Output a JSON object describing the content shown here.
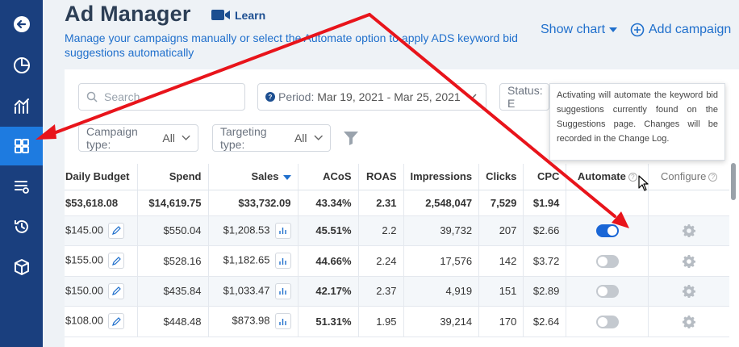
{
  "header": {
    "title": "Ad Manager",
    "learn_label": "Learn",
    "subtitle": "Manage your campaigns manually or select the Automate option to apply ADS keyword bid suggestions automatically",
    "show_chart_label": "Show chart",
    "add_campaign_label": "Add campaign"
  },
  "sidebar": {
    "items": [
      {
        "icon": "back-arrow-icon"
      },
      {
        "icon": "pie-chart-icon"
      },
      {
        "icon": "analytics-icon"
      },
      {
        "icon": "grid-icon",
        "active": true
      },
      {
        "icon": "list-settings-icon"
      },
      {
        "icon": "history-icon"
      },
      {
        "icon": "box-icon"
      }
    ]
  },
  "filters": {
    "search_placeholder": "Search",
    "period_label": "Period:",
    "period_value": "Mar 19, 2021 - Mar 25, 2021",
    "status_label": "Status: E",
    "campaign_type_label": "Campaign type:",
    "campaign_type_value": "All",
    "targeting_type_label": "Targeting type:",
    "targeting_type_value": "All"
  },
  "tooltip": {
    "text": "Activating will automate the keyword bid suggestions currently found on the Suggestions page. Changes will be recorded in the Change Log."
  },
  "table": {
    "headers": {
      "daily_budget": "Daily Budget",
      "spend": "Spend",
      "sales": "Sales",
      "acos": "ACoS",
      "roas": "ROAS",
      "impressions": "Impressions",
      "clicks": "Clicks",
      "cpc": "CPC",
      "automate": "Automate",
      "configure": "Configure"
    },
    "totals": {
      "daily_budget": "$53,618.08",
      "spend": "$14,619.75",
      "sales": "$33,732.09",
      "acos": "43.34%",
      "roas": "2.31",
      "impressions": "2,548,047",
      "clicks": "7,529",
      "cpc": "$1.94"
    },
    "rows": [
      {
        "daily_budget": "$145.00",
        "spend": "$550.04",
        "sales": "$1,208.53",
        "acos": "45.51%",
        "roas": "2.2",
        "impressions": "39,732",
        "clicks": "207",
        "cpc": "$2.66",
        "automate": true
      },
      {
        "daily_budget": "$155.00",
        "spend": "$528.16",
        "sales": "$1,182.65",
        "acos": "44.66%",
        "roas": "2.24",
        "impressions": "17,576",
        "clicks": "142",
        "cpc": "$3.72",
        "automate": false
      },
      {
        "daily_budget": "$150.00",
        "spend": "$435.84",
        "sales": "$1,033.47",
        "acos": "42.17%",
        "roas": "2.37",
        "impressions": "4,919",
        "clicks": "151",
        "cpc": "$2.89",
        "automate": false
      },
      {
        "daily_budget": "$108.00",
        "spend": "$448.48",
        "sales": "$873.98",
        "acos": "51.31%",
        "roas": "1.95",
        "impressions": "39,214",
        "clicks": "170",
        "cpc": "$2.64",
        "automate": false
      }
    ]
  },
  "colors": {
    "sidebar": "#1a3f7e",
    "sidebar_active": "#1e7be0",
    "accent": "#1f6fcc",
    "acos_warning": "#d19b00",
    "acos_good": "#3aa64a",
    "annotation_arrow": "#e8141b"
  }
}
